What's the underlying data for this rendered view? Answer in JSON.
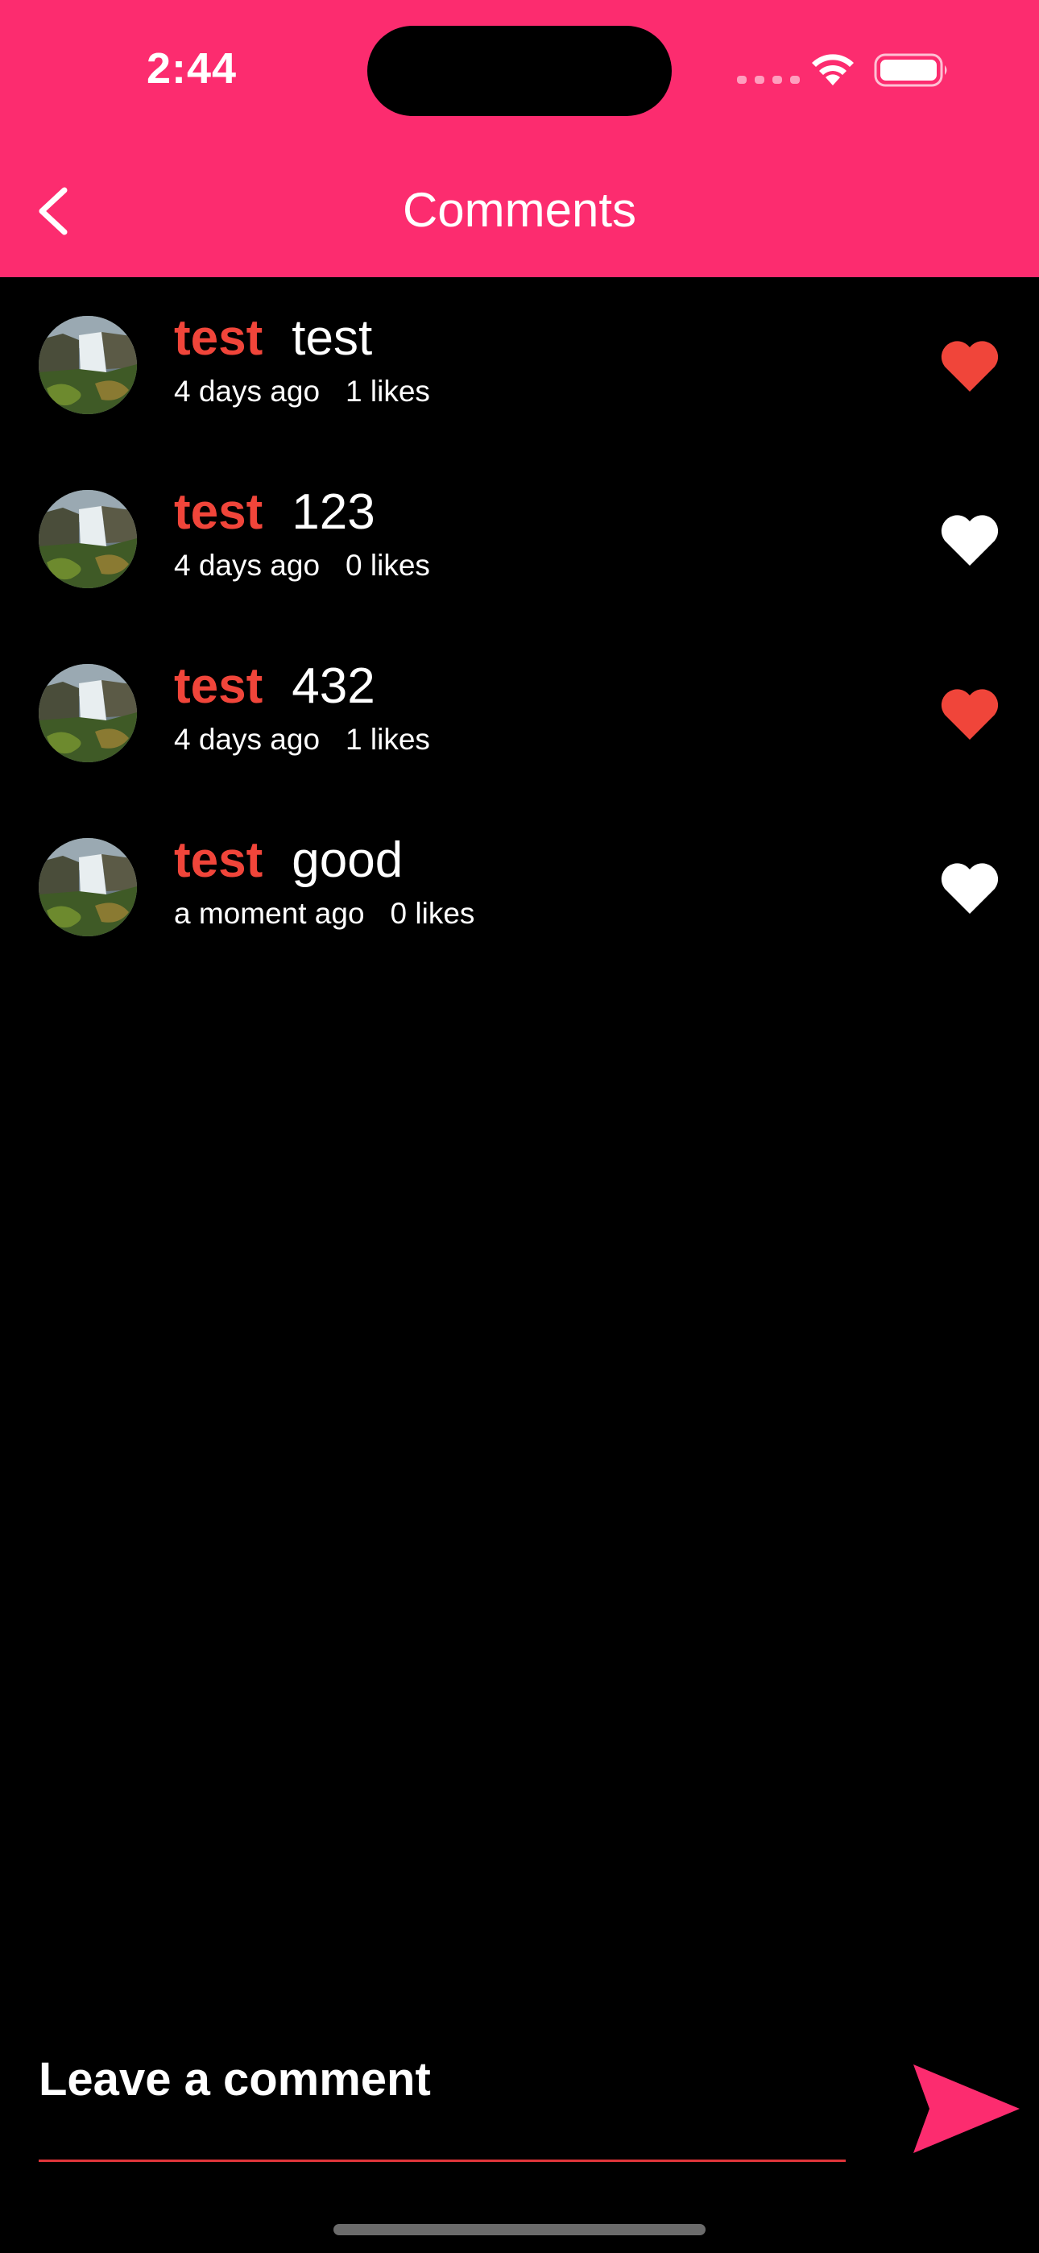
{
  "status_bar": {
    "time": "2:44"
  },
  "header": {
    "title": "Comments",
    "back_icon": "chevron-left-icon"
  },
  "comments": [
    {
      "user": "test",
      "text": "test",
      "time": "4 days ago",
      "likes": "1 likes",
      "liked": true
    },
    {
      "user": "test",
      "text": "123",
      "time": "4 days ago",
      "likes": "0 likes",
      "liked": false
    },
    {
      "user": "test",
      "text": "432",
      "time": "4 days ago",
      "likes": "1 likes",
      "liked": true
    },
    {
      "user": "test",
      "text": "good",
      "time": "a moment ago",
      "likes": "0 likes",
      "liked": false
    }
  ],
  "composer": {
    "placeholder": "Leave a comment",
    "send_icon": "send-icon"
  },
  "colors": {
    "accent": "#fc2c6f",
    "username": "#f0453a",
    "liked_heart": "#f0453a",
    "unliked_heart": "#ffffff",
    "background": "#000000"
  }
}
